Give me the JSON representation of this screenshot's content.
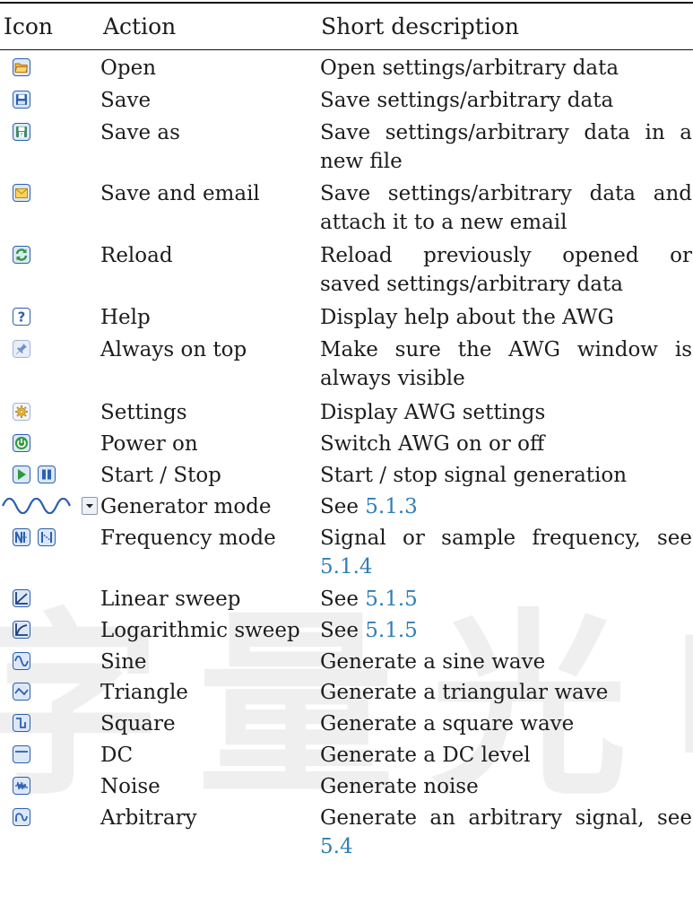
{
  "table": {
    "headers": {
      "icon": "Icon",
      "action": "Action",
      "description": "Short description"
    },
    "rows": [
      {
        "icon": "folder-open-icon",
        "action": "Open",
        "description": [
          "Open settings/arbitrary data"
        ]
      },
      {
        "icon": "save-disk-icon",
        "action": "Save",
        "description": [
          "Save settings/arbitrary data"
        ]
      },
      {
        "icon": "save-as-disk-icon",
        "action": "Save as",
        "description": [
          "Save settings/arbitrary data in a",
          "new file"
        ]
      },
      {
        "icon": "email-envelope-icon",
        "action": "Save and email",
        "description": [
          "Save settings/arbitrary data and",
          "attach it to a new email"
        ]
      },
      {
        "icon": "reload-arrows-icon",
        "action": "Reload",
        "description": [
          "Reload previously opened or",
          "saved settings/arbitrary data"
        ]
      },
      {
        "icon": "help-question-icon",
        "action": "Help",
        "description": [
          "Display help about the AWG"
        ]
      },
      {
        "icon": "pin-always-on-top-icon",
        "action": "Always on top",
        "description": [
          "Make sure the AWG window is",
          "always visible"
        ]
      },
      {
        "icon": "gear-settings-icon",
        "action": "Settings",
        "description": [
          "Display AWG settings"
        ]
      },
      {
        "icon": "power-icon",
        "action": "Power on",
        "description": [
          "Switch AWG on or off"
        ]
      },
      {
        "icon": "play-pause-icon",
        "action": "Start / Stop",
        "description": [
          "Start / stop signal generation"
        ]
      },
      {
        "icon": "generator-mode-dropdown-icon",
        "action": "Generator mode",
        "description": [
          "See "
        ],
        "ref": "5.1.3"
      },
      {
        "icon": "frequency-mode-icon",
        "action": "Frequency mode",
        "description": [
          "Signal or sample frequency, see"
        ],
        "ref": "5.1.4"
      },
      {
        "icon": "linear-sweep-icon",
        "action": "Linear sweep",
        "description": [
          "See "
        ],
        "ref": "5.1.5"
      },
      {
        "icon": "log-sweep-icon",
        "action": "Logarithmic sweep",
        "description": [
          "See "
        ],
        "ref": "5.1.5"
      },
      {
        "icon": "sine-wave-icon",
        "action": "Sine",
        "description": [
          "Generate a sine wave"
        ]
      },
      {
        "icon": "triangle-wave-icon",
        "action": "Triangle",
        "description": [
          "Generate a triangular wave"
        ]
      },
      {
        "icon": "square-wave-icon",
        "action": "Square",
        "description": [
          "Generate a square wave"
        ]
      },
      {
        "icon": "dc-level-icon",
        "action": "DC",
        "description": [
          "Generate a DC level"
        ]
      },
      {
        "icon": "noise-icon",
        "action": "Noise",
        "description": [
          "Generate noise"
        ]
      },
      {
        "icon": "arbitrary-wave-icon",
        "action": "Arbitrary",
        "description": [
          "Generate an arbitrary signal, see"
        ],
        "ref": "5.4"
      }
    ]
  },
  "colors": {
    "link": "#2f7fb6",
    "text": "#1c1c1c",
    "icon_blue": "#2c5fb0",
    "icon_green": "#2e9a3a"
  }
}
